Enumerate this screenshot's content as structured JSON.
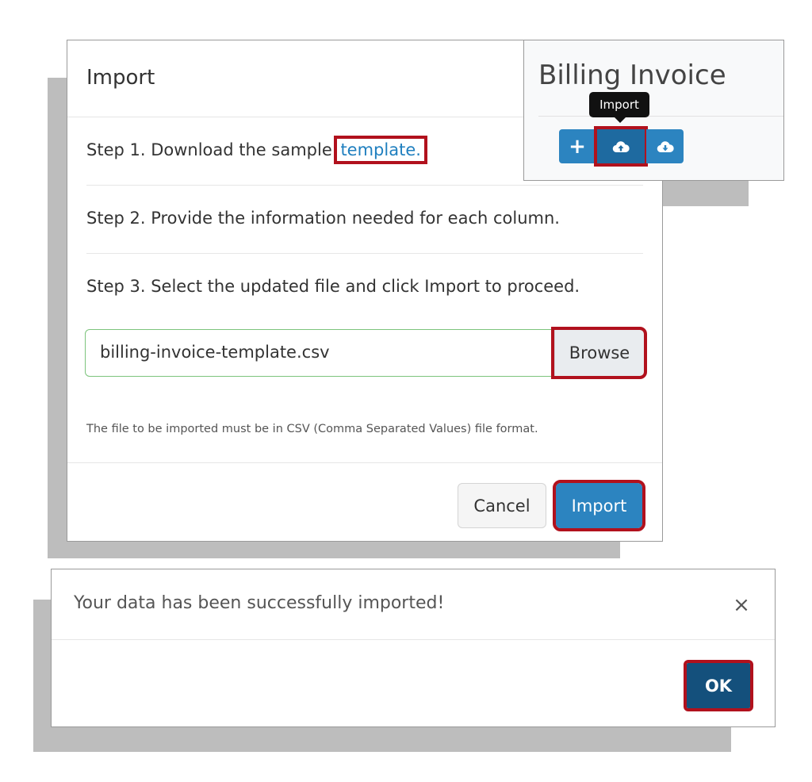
{
  "import_dialog": {
    "title": "Import",
    "step1_prefix": "Step 1. Download the sample ",
    "step1_link": "template.",
    "step2": "Step 2. Provide the information needed for each column.",
    "step3": "Step 3. Select the updated file and click Import to proceed.",
    "file_name": "billing-invoice-template.csv",
    "browse_label": "Browse",
    "hint": "The file to be imported must be in CSV (Comma Separated Values) file format.",
    "cancel_label": "Cancel",
    "import_label": "Import"
  },
  "billing_panel": {
    "title": "Billing Invoice",
    "add_label": "+",
    "tooltip": "Import",
    "toolbar_icons": [
      "plus-icon",
      "cloud-upload-icon",
      "cloud-download-icon"
    ]
  },
  "success_dialog": {
    "message": "Your data has been successfully imported!",
    "close_label": "×",
    "ok_label": "OK"
  },
  "colors": {
    "primary": "#2c84c0",
    "primary_dark": "#14507c",
    "link": "#1f7fbf",
    "highlight": "#b1111d",
    "valid_border": "#7cc47c"
  }
}
